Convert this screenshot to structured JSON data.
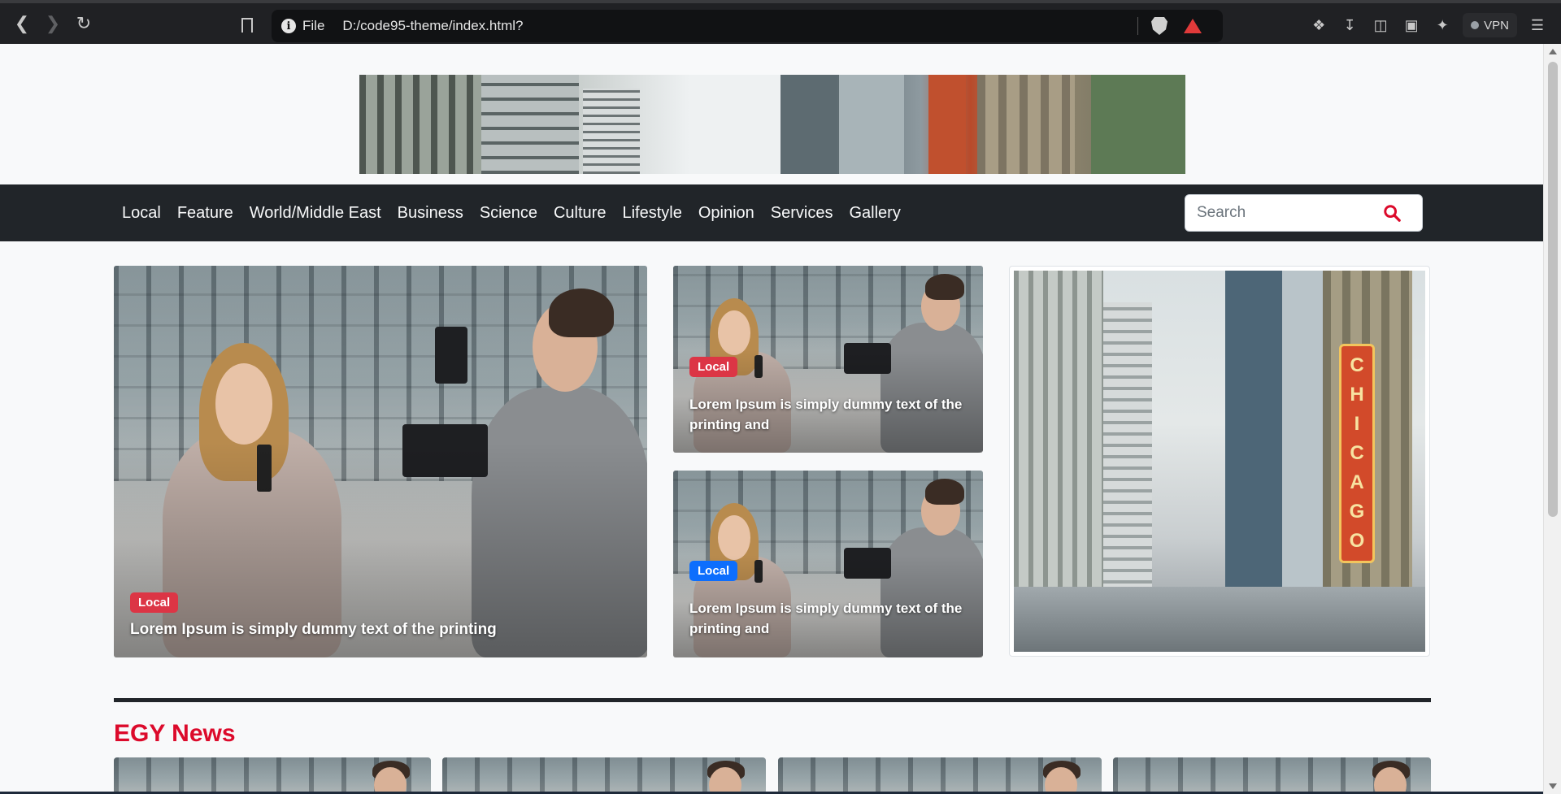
{
  "browser": {
    "file_label": "File",
    "url": "D:/code95-theme/index.html?",
    "vpn_label": "VPN"
  },
  "nav": {
    "links": [
      "Local",
      "Feature",
      "World/Middle East",
      "Business",
      "Science",
      "Culture",
      "Lifestyle",
      "Opinion",
      "Services",
      "Gallery"
    ],
    "search_placeholder": "Search"
  },
  "featured": {
    "main": {
      "badge": "Local",
      "title": "Lorem Ipsum is simply dummy text of the printing"
    },
    "side_top": {
      "badge": "Local",
      "title": "Lorem Ipsum is simply dummy text of the printing and"
    },
    "side_bottom": {
      "badge": "Local",
      "title": "Lorem Ipsum is simply dummy text of the printing and"
    }
  },
  "chicago_sign": [
    "C",
    "H",
    "I",
    "C",
    "A",
    "G",
    "O"
  ],
  "section": {
    "title": "EGY News"
  },
  "colors": {
    "navbar": "#212529",
    "accent_red": "#dc0a2b",
    "badge_red": "#dc3545",
    "badge_blue": "#0d6efd"
  }
}
